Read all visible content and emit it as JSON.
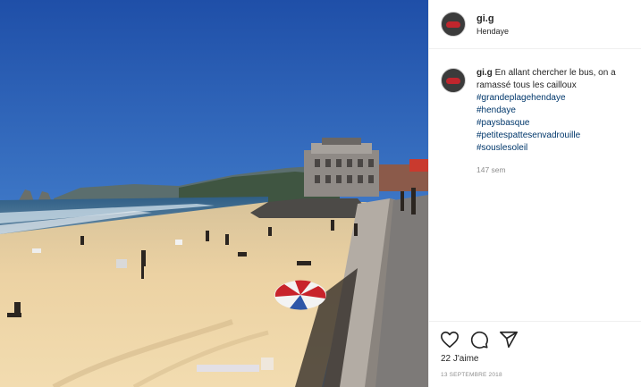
{
  "post": {
    "username": "gi.g",
    "location": "Hendaye",
    "caption_user": "gi.g",
    "caption_text": "En allant chercher le bus, on a ramassé tous les cailloux",
    "hashtags": [
      "#grandeplagehendaye",
      "#hendaye",
      "#paysbasque",
      "#petitespattesenvadrouille",
      "#souslesoleil"
    ],
    "time_ago": "147 sem",
    "likes": "22 J'aime",
    "date": "13 SEPTEMBRE 2018"
  },
  "icons": [
    "heart-icon",
    "comment-icon",
    "share-icon"
  ],
  "colors": {
    "link": "#00376b",
    "text": "#262626",
    "muted": "#8e8e8e",
    "sky": "#2e5fb2",
    "sand": "#e9c99a"
  }
}
